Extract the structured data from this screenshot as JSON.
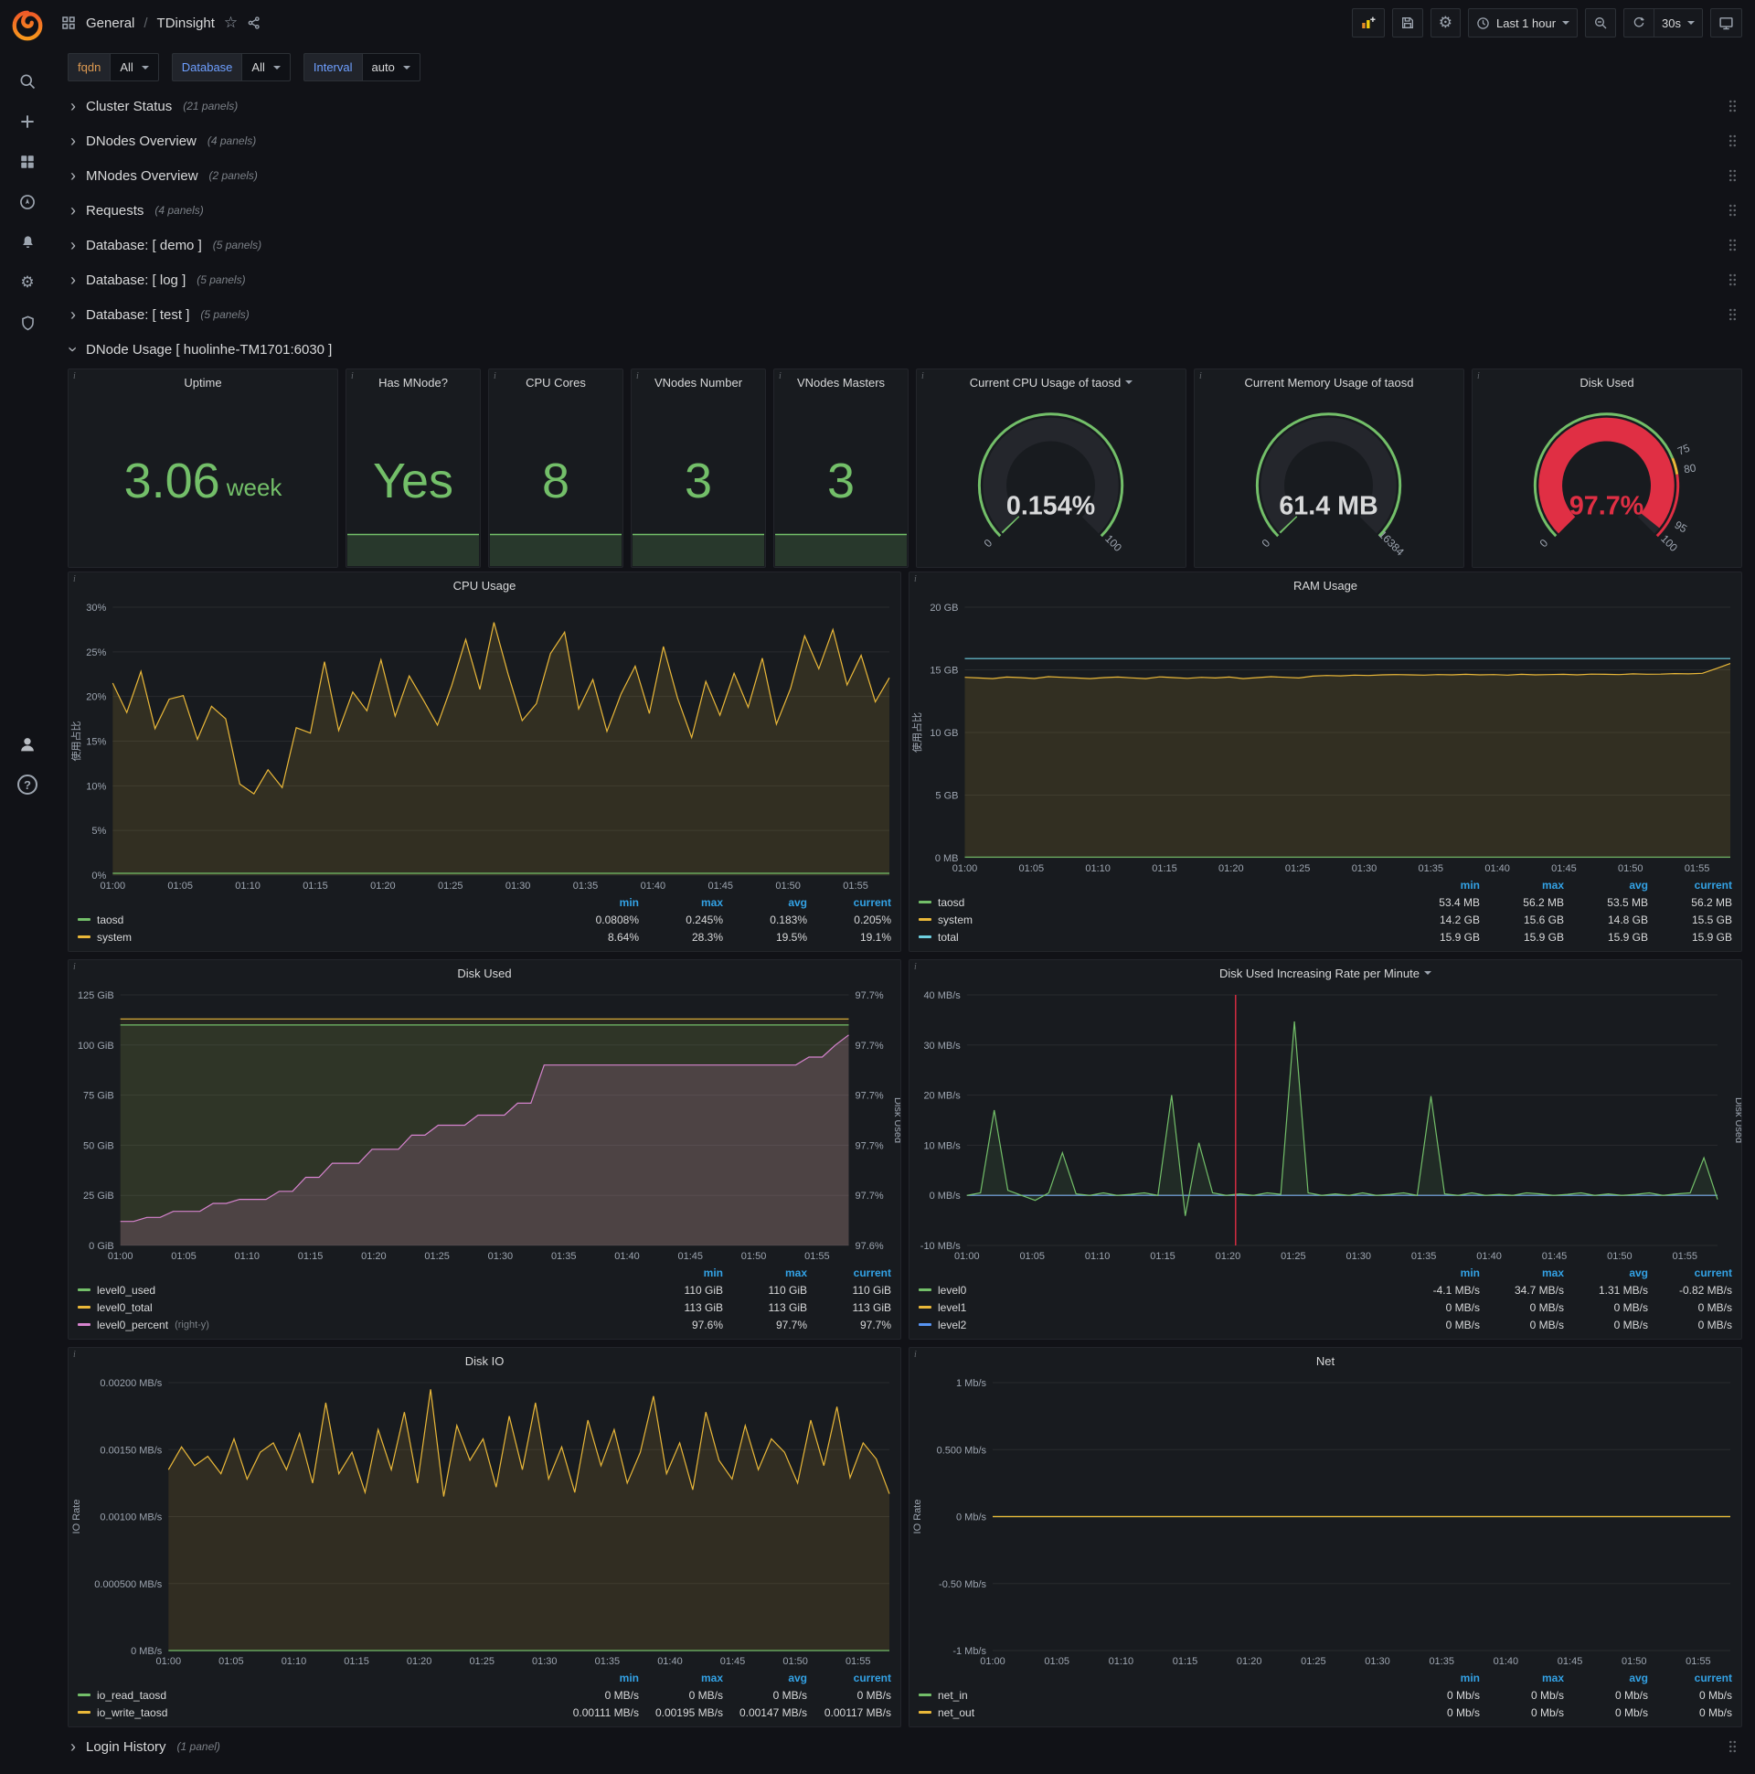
{
  "colors": {
    "background": "#111217",
    "panel": "#181b1f",
    "green": "#73bf69",
    "yellow": "#eab839",
    "cyan": "#6ed0e0",
    "blue": "#5794f2",
    "pink": "#d683ce",
    "red": "#e02f44",
    "legend_header_blue": "#33a2e5",
    "grafana_orange": "#f05a28"
  },
  "sidebar": {
    "icons": [
      "grafana-logo",
      "search-icon",
      "add-icon",
      "dashboards-icon",
      "explore-compass-icon",
      "alerting-bell-icon",
      "configuration-gear-icon",
      "server-admin-shield-icon"
    ],
    "bottom_icons": [
      "user-avatar",
      "help-icon"
    ],
    "help_glyph": "?"
  },
  "navbar": {
    "folder": "General",
    "separator": "/",
    "title": "TDinsight",
    "time_range": "Last 1 hour",
    "refresh_interval": "30s",
    "icons": [
      "dashboards-breadcrumb-icon",
      "star-icon",
      "share-icon",
      "add-panel-icon",
      "save-icon",
      "settings-gear-icon",
      "clock-icon",
      "zoom-out-icon",
      "refresh-icon",
      "cycle-view-monitor-icon"
    ]
  },
  "variables": [
    {
      "label": "fqdn",
      "value": "All",
      "label_color": "#dd9a52"
    },
    {
      "label": "Database",
      "value": "All",
      "label_color": "#6e9fff"
    },
    {
      "label": "Interval",
      "value": "auto",
      "label_color": "#6e9fff"
    }
  ],
  "rows_top": [
    {
      "title": "Cluster Status",
      "count": "(21 panels)"
    },
    {
      "title": "DNodes Overview",
      "count": "(4 panels)"
    },
    {
      "title": "MNodes Overview",
      "count": "(2 panels)"
    },
    {
      "title": "Requests",
      "count": "(4 panels)"
    },
    {
      "title": "Database: [ demo ]",
      "count": "(5 panels)"
    },
    {
      "title": "Database: [ log ]",
      "count": "(5 panels)"
    },
    {
      "title": "Database: [ test ]",
      "count": "(5 panels)"
    }
  ],
  "expanded_row": {
    "title": "DNode Usage [ huolinhe-TM1701:6030 ]"
  },
  "rows_bottom": [
    {
      "title": "Login History",
      "count": "(1 panel)"
    }
  ],
  "stats": [
    {
      "title": "Uptime",
      "value": "3.06",
      "unit": "week",
      "wide": true,
      "sparkline": false
    },
    {
      "title": "Has MNode?",
      "value": "Yes",
      "unit": "",
      "wide": false,
      "sparkline": true
    },
    {
      "title": "CPU Cores",
      "value": "8",
      "unit": "",
      "wide": false,
      "sparkline": true
    },
    {
      "title": "VNodes Number",
      "value": "3",
      "unit": "",
      "wide": false,
      "sparkline": true
    },
    {
      "title": "VNodes Masters",
      "value": "3",
      "unit": "",
      "wide": false,
      "sparkline": true
    }
  ],
  "gauges": [
    {
      "title": "Current CPU Usage of taosd",
      "has_dropdown": true,
      "value": "0.154%",
      "min_label": "0",
      "max_label": "100",
      "fraction": 0.00154,
      "color": "#73bf69",
      "value_color": "#d8d9da",
      "thresholds": []
    },
    {
      "title": "Current Memory Usage of taosd",
      "has_dropdown": false,
      "value": "61.4 MB",
      "min_label": "0",
      "max_label": "16384",
      "fraction": 0.00375,
      "color": "#73bf69",
      "value_color": "#d8d9da",
      "thresholds": []
    },
    {
      "title": "Disk Used",
      "has_dropdown": false,
      "value": "97.7%",
      "min_label": "0",
      "max_label": "",
      "fraction": 0.977,
      "color": "#e02f44",
      "value_color": "#e02f44",
      "thresholds": [
        {
          "label": "75",
          "f": 0.75
        },
        {
          "label": "80",
          "f": 0.8
        },
        {
          "label": "95",
          "f": 0.95
        },
        {
          "label": "100",
          "f": 1.0
        }
      ]
    }
  ],
  "time_ticks": [
    "01:00",
    "01:05",
    "01:10",
    "01:15",
    "01:20",
    "01:25",
    "01:30",
    "01:35",
    "01:40",
    "01:45",
    "01:50",
    "01:55"
  ],
  "charts": [
    {
      "title": "CPU Usage",
      "has_dropdown": false,
      "y": {
        "label": "使用占比",
        "min": 0,
        "max": 30,
        "ticks": [
          "0%",
          "5%",
          "10%",
          "15%",
          "20%",
          "25%",
          "30%"
        ]
      },
      "series": [
        {
          "name": "system",
          "color": "#eab839",
          "fill": 0.13,
          "values": [
            21.5,
            18.2,
            22.8,
            16.4,
            19.7,
            20.1,
            15.2,
            18.9,
            17.5,
            10.2,
            9.1,
            11.8,
            9.8,
            16.5,
            15.9,
            23.9,
            16.2,
            20.5,
            18.4,
            24.1,
            17.8,
            22.3,
            19.6,
            16.8,
            21.2,
            26.4,
            20.8,
            28.3,
            22.5,
            17.3,
            19.2,
            24.8,
            27.2,
            18.6,
            21.9,
            16.1,
            20.3,
            23.4,
            18.1,
            25.6,
            19.8,
            15.4,
            21.7,
            17.9,
            22.6,
            18.8,
            24.3,
            16.9,
            20.9,
            26.8,
            23.1,
            27.5,
            21.3,
            24.6,
            19.4,
            22.1
          ]
        },
        {
          "name": "taosd",
          "color": "#73bf69",
          "values": 0.2
        }
      ],
      "legend": {
        "columns": [
          "min",
          "max",
          "avg",
          "current"
        ],
        "rows": [
          {
            "name": "taosd",
            "color": "#73bf69",
            "values": [
              "0.0808%",
              "0.245%",
              "0.183%",
              "0.205%"
            ]
          },
          {
            "name": "system",
            "color": "#eab839",
            "values": [
              "8.64%",
              "28.3%",
              "19.5%",
              "19.1%"
            ]
          }
        ]
      }
    },
    {
      "title": "RAM Usage",
      "has_dropdown": false,
      "y": {
        "label": "使用占比",
        "min": 0,
        "max": 20,
        "ticks": [
          "0 MB",
          "5 GB",
          "10 GB",
          "15 GB",
          "20 GB"
        ]
      },
      "series": [
        {
          "name": "system",
          "color": "#eab839",
          "fill": 0.13,
          "values": [
            14.4,
            14.35,
            14.3,
            14.42,
            14.38,
            14.31,
            14.45,
            14.4,
            14.35,
            14.3,
            14.38,
            14.42,
            14.36,
            14.3,
            14.44,
            14.38,
            14.32,
            14.4,
            14.35,
            14.42,
            14.3,
            14.38,
            14.45,
            14.4,
            14.35,
            14.5,
            14.55,
            14.52,
            14.58,
            14.55,
            14.6,
            14.62,
            14.6,
            14.58,
            14.62,
            14.6,
            14.64,
            14.6,
            14.62,
            14.58,
            14.64,
            14.6,
            14.62,
            14.64,
            14.6,
            14.66,
            14.64,
            14.62,
            14.68,
            14.65,
            14.66,
            14.7,
            14.68,
            14.72,
            15.1,
            15.5
          ]
        },
        {
          "name": "total",
          "color": "#6ed0e0",
          "values": 15.9
        },
        {
          "name": "taosd",
          "color": "#73bf69",
          "values": 0.053
        }
      ],
      "legend": {
        "columns": [
          "min",
          "max",
          "avg",
          "current"
        ],
        "rows": [
          {
            "name": "taosd",
            "color": "#73bf69",
            "values": [
              "53.4 MB",
              "56.2 MB",
              "53.5 MB",
              "56.2 MB"
            ]
          },
          {
            "name": "system",
            "color": "#eab839",
            "values": [
              "14.2 GB",
              "15.6 GB",
              "14.8 GB",
              "15.5 GB"
            ]
          },
          {
            "name": "total",
            "color": "#6ed0e0",
            "values": [
              "15.9 GB",
              "15.9 GB",
              "15.9 GB",
              "15.9 GB"
            ]
          }
        ]
      }
    },
    {
      "title": "Disk Used",
      "has_dropdown": false,
      "y": {
        "label": "",
        "min": 0,
        "max": 125,
        "ticks": [
          "0 GiB",
          "25 GiB",
          "50 GiB",
          "75 GiB",
          "100 GiB",
          "125 GiB"
        ]
      },
      "y2": {
        "label": "Disk Used",
        "ticks": [
          "97.6%",
          "97.7%",
          "97.7%",
          "97.7%",
          "97.7%",
          "97.7%"
        ]
      },
      "series": [
        {
          "name": "level0_total",
          "color": "#eab839",
          "fill": 0.07,
          "values": 113
        },
        {
          "name": "level0_used",
          "color": "#73bf69",
          "fill": 0.1,
          "values": 110
        },
        {
          "name": "level0_percent",
          "color": "#d683ce",
          "fill": 0.18,
          "fill_to": 97.595,
          "axis": "right",
          "range": [
            97.595,
            97.72
          ],
          "values": [
            97.607,
            97.607,
            97.609,
            97.609,
            97.612,
            97.612,
            97.612,
            97.616,
            97.616,
            97.618,
            97.618,
            97.618,
            97.622,
            97.622,
            97.629,
            97.629,
            97.636,
            97.636,
            97.636,
            97.643,
            97.643,
            97.643,
            97.65,
            97.65,
            97.655,
            97.655,
            97.655,
            97.66,
            97.66,
            97.66,
            97.666,
            97.666,
            97.685,
            97.685,
            97.685,
            97.685,
            97.685,
            97.685,
            97.685,
            97.685,
            97.685,
            97.685,
            97.685,
            97.685,
            97.685,
            97.685,
            97.685,
            97.685,
            97.685,
            97.685,
            97.685,
            97.685,
            97.689,
            97.689,
            97.695,
            97.7
          ]
        }
      ],
      "legend": {
        "columns": [
          "min",
          "max",
          "current"
        ],
        "rows": [
          {
            "name": "level0_used",
            "color": "#73bf69",
            "values": [
              "110 GiB",
              "110 GiB",
              "110 GiB"
            ]
          },
          {
            "name": "level0_total",
            "color": "#eab839",
            "values": [
              "113 GiB",
              "113 GiB",
              "113 GiB"
            ]
          },
          {
            "name": "level0_percent",
            "color": "#d683ce",
            "note": "(right-y)",
            "values": [
              "97.6%",
              "97.7%",
              "97.7%"
            ]
          }
        ]
      }
    },
    {
      "title": "Disk Used Increasing Rate per Minute",
      "has_dropdown": true,
      "y": {
        "label": "",
        "min": -10,
        "max": 40,
        "ticks": [
          "-10 MB/s",
          "0 MB/s",
          "10 MB/s",
          "20 MB/s",
          "30 MB/s",
          "40 MB/s"
        ]
      },
      "y2": {
        "label": "Disk Used",
        "ticks": []
      },
      "annotation_f": 0.358,
      "series": [
        {
          "name": "level1",
          "color": "#eab839",
          "values": 0
        },
        {
          "name": "level2",
          "color": "#5794f2",
          "values": 0
        },
        {
          "name": "level0",
          "color": "#73bf69",
          "fill": 0.1,
          "values": [
            0,
            0.5,
            17,
            1,
            0,
            -1,
            0.5,
            8.5,
            0.3,
            0,
            0.5,
            0,
            0.2,
            0.5,
            0,
            20,
            -4.1,
            10.5,
            0.5,
            0,
            0.3,
            0,
            0.5,
            0.2,
            34.7,
            0.5,
            0,
            0.3,
            0,
            0.5,
            0,
            0.2,
            0.5,
            0,
            19.8,
            0.3,
            0,
            0.5,
            0,
            0.2,
            0,
            0.5,
            0.3,
            0,
            0.2,
            0.5,
            0,
            0.3,
            0,
            0.2,
            0.5,
            0,
            0.3,
            0.5,
            7.5,
            -0.82
          ]
        }
      ],
      "legend": {
        "columns": [
          "min",
          "max",
          "avg",
          "current"
        ],
        "rows": [
          {
            "name": "level0",
            "color": "#73bf69",
            "values": [
              "-4.1 MB/s",
              "34.7 MB/s",
              "1.31 MB/s",
              "-0.82 MB/s"
            ]
          },
          {
            "name": "level1",
            "color": "#eab839",
            "values": [
              "0 MB/s",
              "0 MB/s",
              "0 MB/s",
              "0 MB/s"
            ]
          },
          {
            "name": "level2",
            "color": "#5794f2",
            "values": [
              "0 MB/s",
              "0 MB/s",
              "0 MB/s",
              "0 MB/s"
            ]
          }
        ]
      }
    },
    {
      "title": "Disk IO",
      "has_dropdown": false,
      "y": {
        "label": "IO Rate",
        "min": 0,
        "max": 0.002,
        "ticks": [
          "0 MB/s",
          "0.000500 MB/s",
          "0.00100 MB/s",
          "0.00150 MB/s",
          "0.00200 MB/s"
        ]
      },
      "series": [
        {
          "name": "io_write_taosd",
          "color": "#eab839",
          "fill": 0.12,
          "values": [
            0.00135,
            0.00152,
            0.00138,
            0.00145,
            0.00132,
            0.00158,
            0.00128,
            0.00148,
            0.00155,
            0.00135,
            0.00162,
            0.00125,
            0.00185,
            0.00132,
            0.00148,
            0.00118,
            0.00165,
            0.00135,
            0.00178,
            0.00125,
            0.00195,
            0.00115,
            0.00168,
            0.00142,
            0.00158,
            0.00122,
            0.00175,
            0.00135,
            0.00185,
            0.00128,
            0.00152,
            0.00118,
            0.00172,
            0.00138,
            0.00165,
            0.00125,
            0.00148,
            0.0019,
            0.00132,
            0.00155,
            0.0012,
            0.00178,
            0.00142,
            0.00128,
            0.00168,
            0.00135,
            0.00158,
            0.00148,
            0.00125,
            0.00172,
            0.00138,
            0.00182,
            0.00129,
            0.00155,
            0.00143,
            0.00117
          ]
        },
        {
          "name": "io_read_taosd",
          "color": "#73bf69",
          "values": 0
        }
      ],
      "legend": {
        "columns": [
          "min",
          "max",
          "avg",
          "current"
        ],
        "rows": [
          {
            "name": "io_read_taosd",
            "color": "#73bf69",
            "values": [
              "0 MB/s",
              "0 MB/s",
              "0 MB/s",
              "0 MB/s"
            ]
          },
          {
            "name": "io_write_taosd",
            "color": "#eab839",
            "values": [
              "0.00111 MB/s",
              "0.00195 MB/s",
              "0.00147 MB/s",
              "0.00117 MB/s"
            ]
          }
        ]
      }
    },
    {
      "title": "Net",
      "has_dropdown": false,
      "y": {
        "label": "IO Rate",
        "min": -1,
        "max": 1,
        "ticks": [
          "-1 Mb/s",
          "-0.50 Mb/s",
          "0 Mb/s",
          "0.500 Mb/s",
          "1 Mb/s"
        ]
      },
      "series": [
        {
          "name": "net_in",
          "color": "#73bf69",
          "values": 0
        },
        {
          "name": "net_out",
          "color": "#eab839",
          "values": 0
        }
      ],
      "legend": {
        "columns": [
          "min",
          "max",
          "avg",
          "current"
        ],
        "rows": [
          {
            "name": "net_in",
            "color": "#73bf69",
            "values": [
              "0 Mb/s",
              "0 Mb/s",
              "0 Mb/s",
              "0 Mb/s"
            ]
          },
          {
            "name": "net_out",
            "color": "#eab839",
            "values": [
              "0 Mb/s",
              "0 Mb/s",
              "0 Mb/s",
              "0 Mb/s"
            ]
          }
        ]
      }
    }
  ]
}
